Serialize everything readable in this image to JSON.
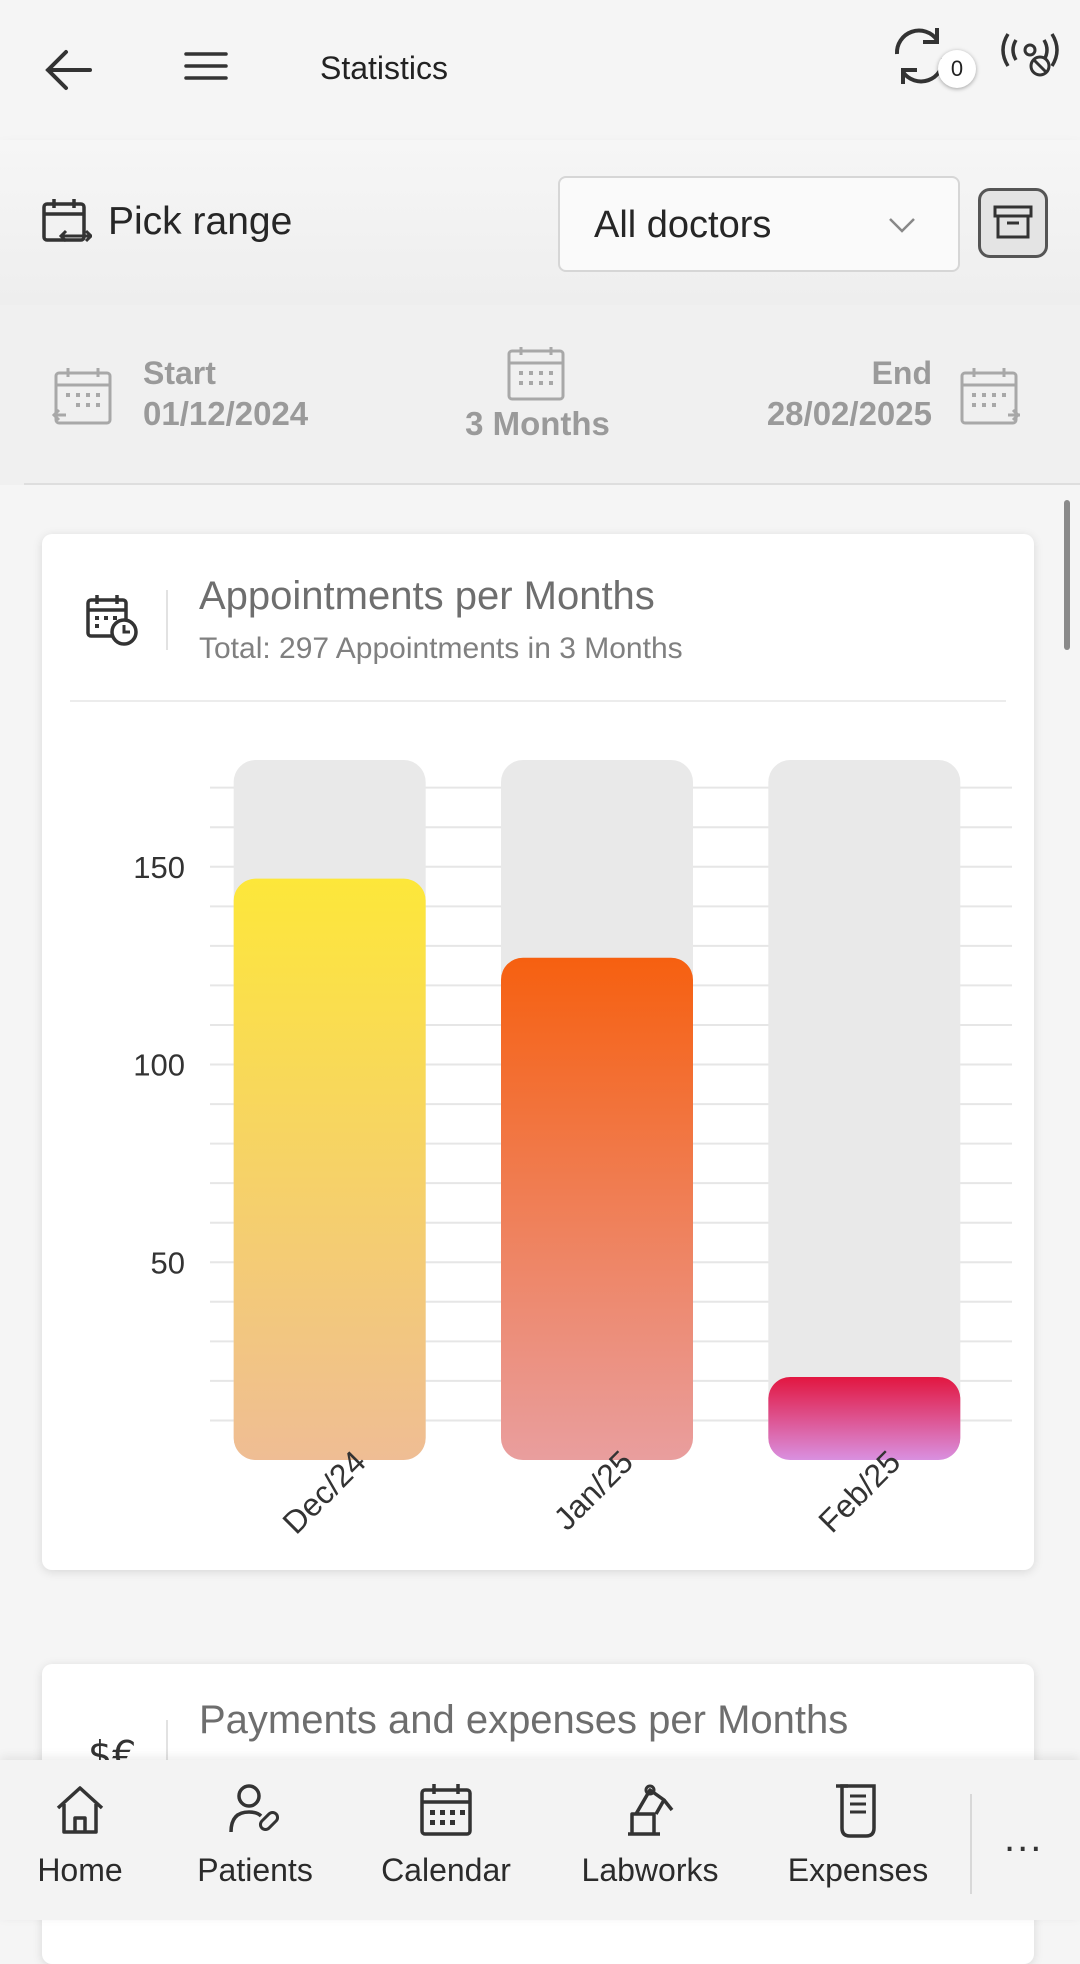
{
  "header": {
    "title": "Statistics",
    "sync_count": "0"
  },
  "toolbar": {
    "pick_range_label": "Pick range",
    "doctor_filter_value": "All doctors"
  },
  "date_range": {
    "start_label": "Start",
    "start_date": "01/12/2024",
    "duration": "3 Months",
    "end_label": "End",
    "end_date": "28/02/2025"
  },
  "cards": [
    {
      "title": "Appointments per Months",
      "subtitle": "Total: 297 Appointments in 3 Months"
    },
    {
      "title": "Payments and expenses per Months"
    }
  ],
  "chart_data": {
    "type": "bar",
    "categories": [
      "Dec/24",
      "Jan/25",
      "Feb/25"
    ],
    "values": [
      147,
      127,
      21
    ],
    "background_max": 177,
    "yticks": [
      50,
      100,
      150
    ],
    "ylim": [
      0,
      177
    ],
    "title": "Appointments per Months",
    "subtitle": "Total: 297 Appointments in 3 Months",
    "xlabel": "",
    "ylabel": "",
    "grid": true,
    "bar_gradients": [
      {
        "top": "#fde73a",
        "bottom": "#efbd94"
      },
      {
        "top": "#f66010",
        "bottom": "#e99e9e"
      },
      {
        "top": "#e21640",
        "bottom": "#d990e0"
      }
    ],
    "background_bar_color": "#e9e9e9"
  },
  "bottom_nav": {
    "items": [
      {
        "label": "Home",
        "icon": "home-icon"
      },
      {
        "label": "Patients",
        "icon": "patients-icon"
      },
      {
        "label": "Calendar",
        "icon": "calendar-icon"
      },
      {
        "label": "Labworks",
        "icon": "labworks-icon"
      },
      {
        "label": "Expenses",
        "icon": "expenses-icon"
      }
    ],
    "more_label": "..."
  }
}
